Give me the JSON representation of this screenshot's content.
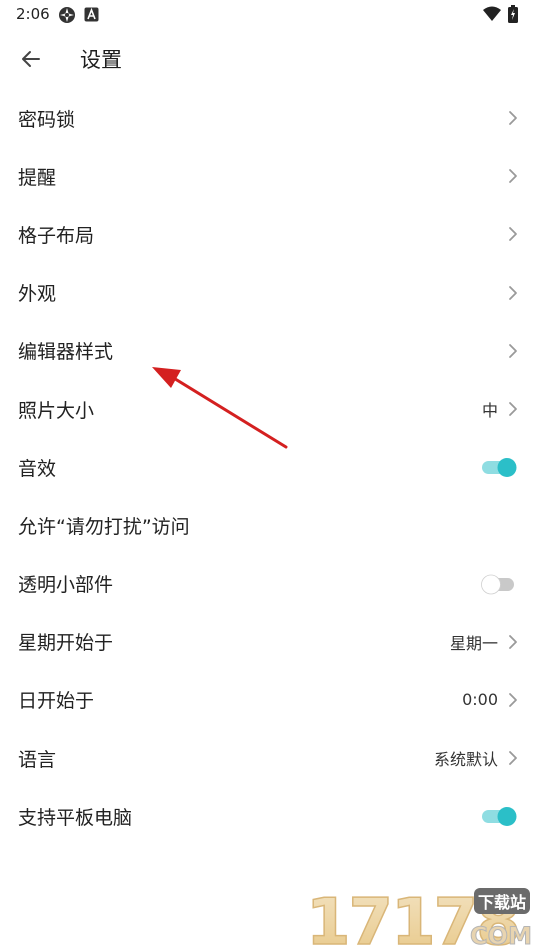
{
  "status_bar": {
    "time": "2:06",
    "icons": [
      "settings-wheel-icon",
      "a-notification-icon",
      "wifi-icon",
      "battery-icon"
    ]
  },
  "app_bar": {
    "back_icon": "arrow-left-icon",
    "title": "设置"
  },
  "settings": [
    {
      "label": "密码锁",
      "control": "chevron"
    },
    {
      "label": "提醒",
      "control": "chevron"
    },
    {
      "label": "格子布局",
      "control": "chevron"
    },
    {
      "label": "外观",
      "control": "chevron"
    },
    {
      "label": "编辑器样式",
      "control": "chevron"
    },
    {
      "label": "照片大小",
      "value": "中",
      "control": "chevron"
    },
    {
      "label": "音效",
      "control": "switch",
      "on": true
    },
    {
      "label": "允许“请勿打扰”访问",
      "control": "none"
    },
    {
      "label": "透明小部件",
      "control": "switch",
      "on": false
    },
    {
      "label": "星期开始于",
      "value": "星期一",
      "control": "chevron"
    },
    {
      "label": "日开始于",
      "value": "0:00",
      "control": "chevron"
    },
    {
      "label": "语言",
      "value": "系统默认",
      "control": "chevron"
    },
    {
      "label": "支持平板电脑",
      "control": "switch",
      "on": true
    }
  ],
  "colors": {
    "accent": "#2bbfc8",
    "track_on": "#8fdde2",
    "annotation_arrow": "#d42020"
  },
  "watermark": {
    "number": "17178",
    "badge": "下载站",
    "domain": "COM"
  }
}
